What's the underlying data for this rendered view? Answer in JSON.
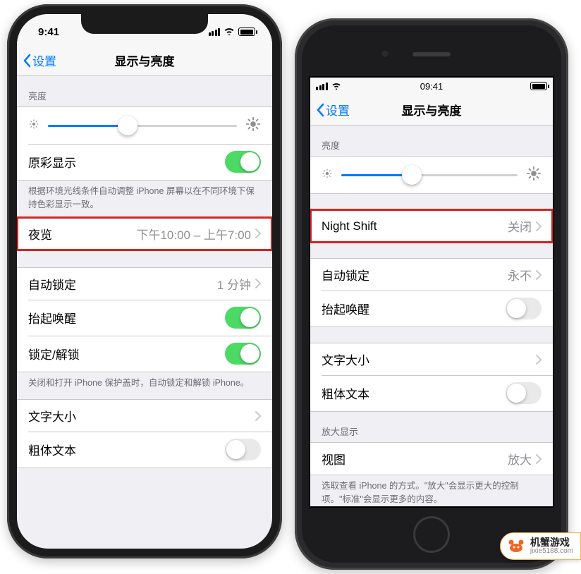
{
  "phone_x": {
    "status": {
      "time": "9:41"
    },
    "nav": {
      "back": "设置",
      "title": "显示与亮度"
    },
    "brightness": {
      "header": "亮度",
      "slider_pct": 42
    },
    "true_tone": {
      "label": "原彩显示",
      "on": true
    },
    "true_tone_footer": "根据环境光线条件自动调整 iPhone 屏幕以在不同环境下保持色彩显示一致。",
    "night_shift": {
      "label": "夜览",
      "value": "下午10:00 – 上午7:00"
    },
    "auto_lock": {
      "label": "自动锁定",
      "value": "1 分钟"
    },
    "raise_to_wake": {
      "label": "抬起唤醒",
      "on": true
    },
    "lock_unlock": {
      "label": "锁定/解锁",
      "on": true
    },
    "lock_footer": "关闭和打开 iPhone 保护盖时，自动锁定和解锁 iPhone。",
    "text_size": {
      "label": "文字大小"
    },
    "bold_text": {
      "label": "粗体文本",
      "on": false
    }
  },
  "phone_8": {
    "status": {
      "time": "09:41"
    },
    "nav": {
      "back": "设置",
      "title": "显示与亮度"
    },
    "brightness": {
      "header": "亮度",
      "slider_pct": 40
    },
    "night_shift": {
      "label": "Night Shift",
      "value": "关闭"
    },
    "auto_lock": {
      "label": "自动锁定",
      "value": "永不"
    },
    "raise_to_wake": {
      "label": "抬起唤醒",
      "on": false
    },
    "text_size": {
      "label": "文字大小"
    },
    "bold_text": {
      "label": "粗体文本",
      "on": false
    },
    "zoom_header": "放大显示",
    "zoom": {
      "label": "视图",
      "value": "放大"
    },
    "zoom_footer": "选取查看 iPhone 的方式。\"放大\"会显示更大的控制项。\"标准\"会显示更多的内容。"
  },
  "watermark": {
    "title": "机蟹游戏",
    "url": "jixie5188.com"
  }
}
